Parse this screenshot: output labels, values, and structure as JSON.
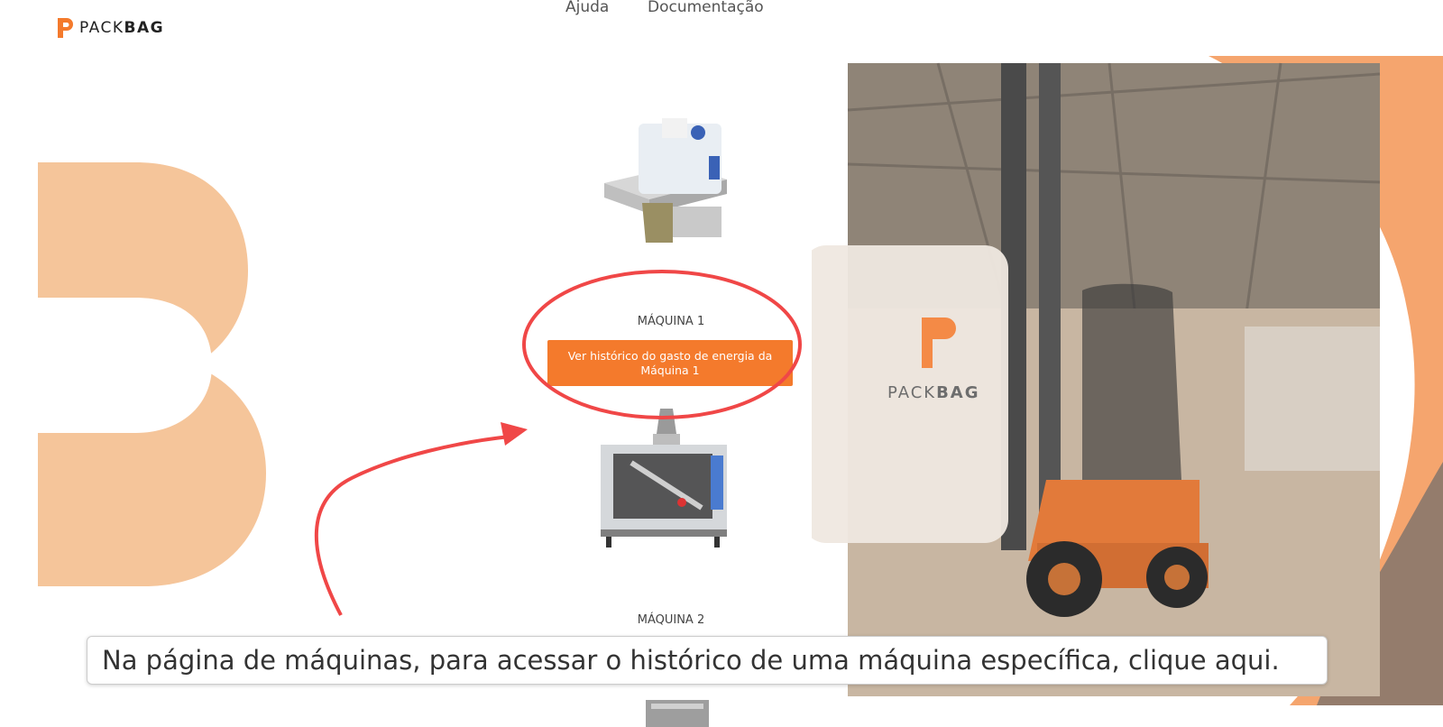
{
  "brand": {
    "name_light": "PACK",
    "name_bold": "BAG",
    "accent_color": "#f47a2c",
    "soft_accent_color": "#f5c59a"
  },
  "nav": {
    "items": [
      "Ajuda",
      "Documentação"
    ]
  },
  "machines": [
    {
      "title": "MÁQUINA 1",
      "button_label": "Ver histórico do gasto de energia da Máquina 1"
    },
    {
      "title": "MÁQUINA 2"
    }
  ],
  "hero": {
    "bag_logo_light": "PACK",
    "bag_logo_bold": "BAG"
  },
  "annotation": {
    "text": "Na página de máquinas, para acessar o histórico de uma máquina específica, clique aqui.",
    "highlight_color": "#f04747"
  },
  "icons": [
    "packbag-logo-icon",
    "sewing-machine-image",
    "packaging-machine-image",
    "forklift-photo"
  ]
}
